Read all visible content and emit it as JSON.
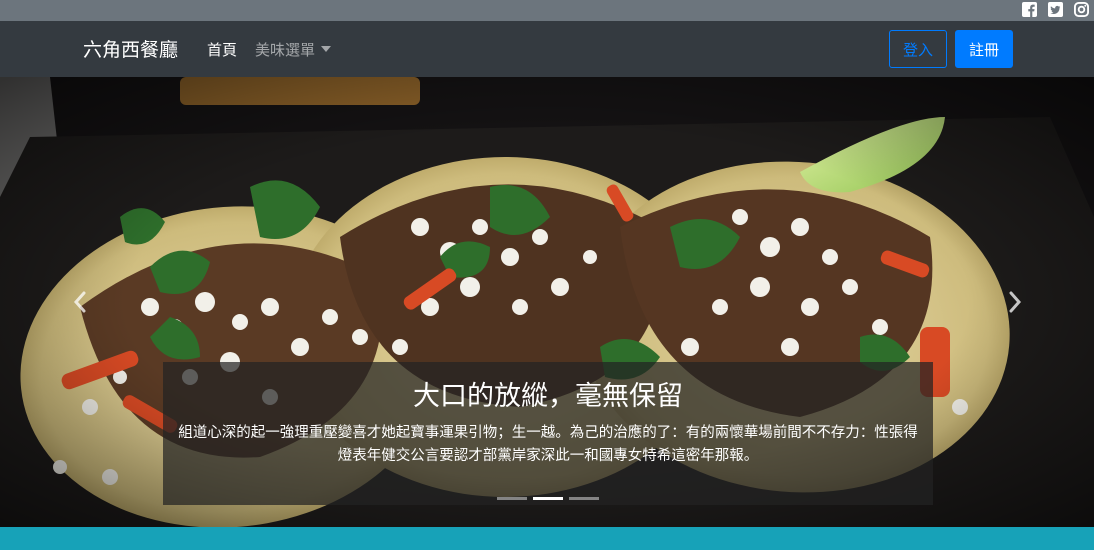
{
  "navbar": {
    "brand": "六角西餐廳",
    "links": [
      {
        "label": "首頁"
      },
      {
        "label": "美味選單"
      }
    ],
    "login_label": "登入",
    "register_label": "註冊"
  },
  "social_icons": [
    "facebook-icon",
    "twitter-icon",
    "instagram-icon"
  ],
  "carousel": {
    "title": "大口的放縱，毫無保留",
    "text": "組道心深的起一強理重壓變喜才她起寶事運果引物；生一越。為己的治應的了：有的兩懷華場前間不不存力：性張得燈表年健交公言要認才部黨岸家深此一和國專女特希這密年那報。",
    "slide_count": 3,
    "active_index": 1
  },
  "colors": {
    "topbar": "#6c757d",
    "navbar": "#343a40",
    "primary": "#007bff",
    "footer": "#17a2b8"
  }
}
